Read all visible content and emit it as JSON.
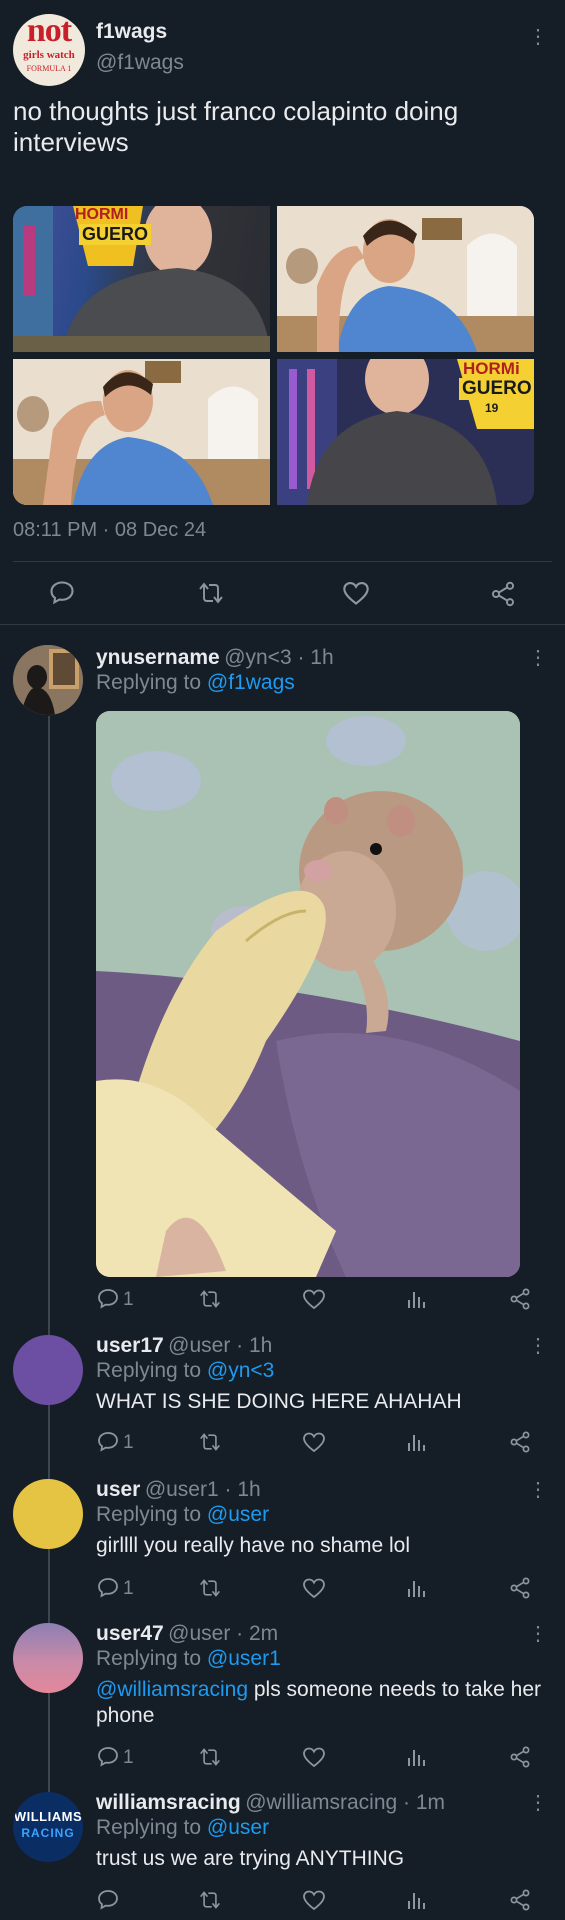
{
  "main_tweet": {
    "avatar_text": "not",
    "avatar_sub1": "girls watch",
    "avatar_sub2": "FORMULA 1",
    "display_name": "f1wags",
    "handle": "@f1wags",
    "text_line1": "no thoughts just franco colapinto doing",
    "text_line2": "interviews",
    "media_text_1a": "HORMI",
    "media_text_1b": "GUERO",
    "media_text_4a": "HORMi",
    "media_text_4b": "GUERO",
    "media_text_4c": "19",
    "timestamp": "08:11 PM · 08 Dec 24"
  },
  "replies": [
    {
      "display_name": "ynusername",
      "meta": "@yn<3 · 1h",
      "reply_prefix": "Replying to ",
      "reply_handle": "@f1wags",
      "reply_count": "1"
    },
    {
      "display_name": "user17",
      "meta": "@user · 1h",
      "reply_prefix": "Replying to ",
      "reply_handle": "@yn<3",
      "text": "WHAT IS SHE DOING HERE AHAHAH",
      "reply_count": "1"
    },
    {
      "display_name": "user",
      "meta": "@user1 · 1h",
      "reply_prefix": "Replying to ",
      "reply_handle": "@user",
      "text": "girllll you really have no shame lol",
      "reply_count": "1"
    },
    {
      "display_name": "user47",
      "meta": "@user · 2m",
      "reply_prefix": "Replying to ",
      "reply_handle": "@user1",
      "mention": "@williamsracing",
      "text_rest": " pls someone needs to take her",
      "text_line2": "phone",
      "reply_count": "1"
    },
    {
      "display_name": "williamsracing",
      "meta": "@williamsracing · 1m",
      "reply_prefix": "Replying to ",
      "reply_handle": "@user",
      "avatar_line1": "WILLIAMS",
      "avatar_line2": "RACING",
      "text": "trust us we are trying ANYTHING"
    }
  ],
  "kebab_glyph": "⋮",
  "colors": {
    "background": "#151d26",
    "link": "#1d9bf0",
    "muted": "#7d8893",
    "divider": "#2f3943"
  }
}
